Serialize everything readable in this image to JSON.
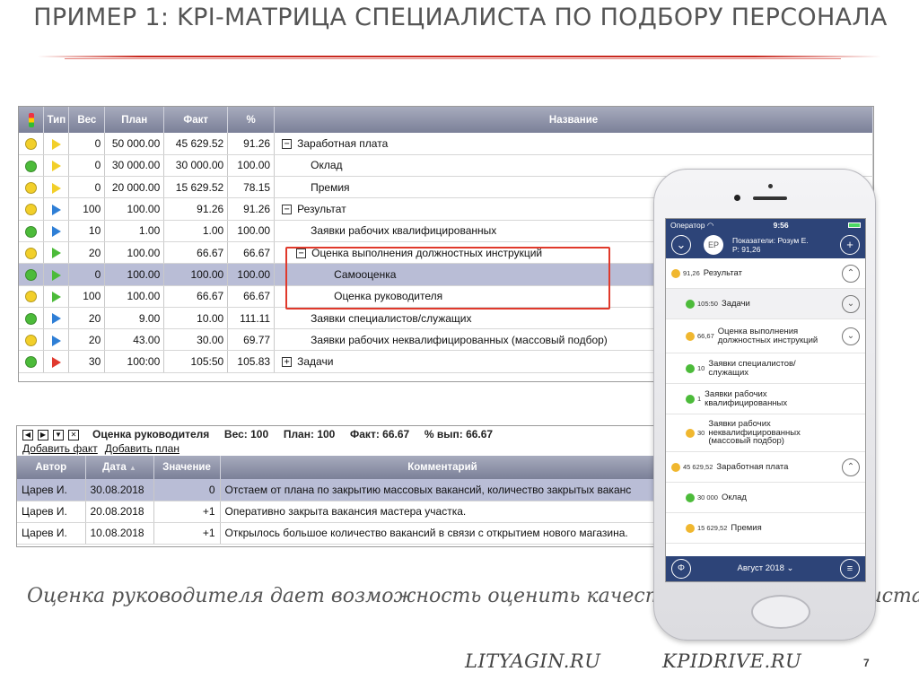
{
  "slide": {
    "title": "ПРИМЕР 1: KPI-МАТРИЦА СПЕЦИАЛИСТА ПО ПОДБОРУ ПЕРСОНАЛА",
    "caption": "Оценка руководителя дает возможность оценить качество работы специалиста",
    "footer_left": "LITYAGIN.RU",
    "footer_right": "KPIDRIVE.RU",
    "page": "7"
  },
  "colors": {
    "accent": "#c8281e",
    "header_grad": "#7b8098",
    "selected": "#b9bdd6",
    "yellow": "#f2cf2a",
    "green": "#4cbb3a",
    "red": "#e03a2f",
    "blue": "#2f7fd6",
    "app_blue": "#2d4478"
  },
  "kpi": {
    "columns": [
      "",
      "Тип",
      "Вес",
      "План",
      "Факт",
      "%",
      "Название"
    ],
    "rows": [
      {
        "status": "yellow",
        "type": "yellow",
        "weight": "0",
        "plan": "50 000.00",
        "fact": "45 629.52",
        "pct": "91.26",
        "toggle": "minus",
        "name": "Заработная плата",
        "level": 0
      },
      {
        "status": "green",
        "type": "yellow",
        "weight": "0",
        "plan": "30 000.00",
        "fact": "30 000.00",
        "pct": "100.00",
        "toggle": "",
        "name": "Оклад",
        "level": 1
      },
      {
        "status": "yellow",
        "type": "yellow",
        "weight": "0",
        "plan": "20 000.00",
        "fact": "15 629.52",
        "pct": "78.15",
        "toggle": "",
        "name": "Премия",
        "level": 1
      },
      {
        "status": "yellow",
        "type": "blue",
        "weight": "100",
        "plan": "100.00",
        "fact": "91.26",
        "pct": "91.26",
        "toggle": "minus",
        "name": "Результат",
        "level": 0
      },
      {
        "status": "green",
        "type": "blue",
        "weight": "10",
        "plan": "1.00",
        "fact": "1.00",
        "pct": "100.00",
        "toggle": "",
        "name": "Заявки рабочих квалифицированных",
        "level": 1
      },
      {
        "status": "yellow",
        "type": "green",
        "weight": "20",
        "plan": "100.00",
        "fact": "66.67",
        "pct": "66.67",
        "toggle": "minus",
        "name": "Оценка выполнения должностных инструкций",
        "level": 1
      },
      {
        "status": "green",
        "type": "green",
        "weight": "0",
        "plan": "100.00",
        "fact": "100.00",
        "pct": "100.00",
        "toggle": "",
        "name": "Самооценка",
        "level": 2,
        "selected": true
      },
      {
        "status": "yellow",
        "type": "green",
        "weight": "100",
        "plan": "100.00",
        "fact": "66.67",
        "pct": "66.67",
        "toggle": "",
        "name": "Оценка руководителя",
        "level": 2
      },
      {
        "status": "green",
        "type": "blue",
        "weight": "20",
        "plan": "9.00",
        "fact": "10.00",
        "pct": "111.11",
        "toggle": "",
        "name": "Заявки специалистов/служащих",
        "level": 1
      },
      {
        "status": "yellow",
        "type": "blue",
        "weight": "20",
        "plan": "43.00",
        "fact": "30.00",
        "pct": "69.77",
        "toggle": "",
        "name": "Заявки рабочих неквалифицированных (массовый подбор)",
        "level": 1
      },
      {
        "status": "green",
        "type": "red",
        "weight": "30",
        "plan": "100:00",
        "fact": "105:50",
        "pct": "105.83",
        "toggle": "plus",
        "name": "Задачи",
        "level": 0
      }
    ]
  },
  "detail": {
    "title": "Оценка руководителя",
    "weight": "Вес: 100",
    "plan": "План: 100",
    "fact": "Факт: 66.67",
    "pct": "% вып: 66.67",
    "add_fact": "Добавить факт",
    "add_plan": "Добавить план",
    "columns": [
      "Автор",
      "Дата",
      "Значение",
      "Комментарий"
    ],
    "rows": [
      {
        "author": "Царев И.",
        "date": "30.08.2018",
        "value": "0",
        "comment": "Отстаем от плана по закрытию массовых вакансий, количество закрытых ваканс",
        "selected": true
      },
      {
        "author": "Царев И.",
        "date": "20.08.2018",
        "value": "+1",
        "comment": "Оперативно закрыта вакансия мастера участка."
      },
      {
        "author": "Царев И.",
        "date": "10.08.2018",
        "value": "+1",
        "comment": "Открылось большое количество вакансий в связи с открытием нового магазина."
      }
    ]
  },
  "phone": {
    "carrier": "Оператор",
    "time": "9:56",
    "avatar": "ЕР",
    "header_line1": "Показатели: Розум Е.",
    "header_line2": "Р: 91,26",
    "month": "Август 2018 ⌄",
    "items": [
      {
        "color": "#f0b72f",
        "value": "91,26",
        "name": "Результат",
        "indent": 0,
        "chev": "up",
        "h": 34
      },
      {
        "color": "#4cbb3a",
        "value": "105:50",
        "name": "Задачи",
        "indent": 1,
        "chev": "down",
        "h": 34,
        "hl": true
      },
      {
        "color": "#f0b72f",
        "value": "66,67",
        "name": "Оценка выполнения должностных инструкций",
        "indent": 1,
        "chev": "down",
        "h": 38
      },
      {
        "color": "#4cbb3a",
        "value": "10",
        "name": "Заявки специалистов/ служащих",
        "indent": 1,
        "chev": "",
        "h": 34
      },
      {
        "color": "#4cbb3a",
        "value": "1",
        "name": "Заявки рабочих квалифицированных",
        "indent": 1,
        "chev": "",
        "h": 34
      },
      {
        "color": "#f0b72f",
        "value": "30",
        "name": "Заявки рабочих неквалифицированных (массовый подбор)",
        "indent": 1,
        "chev": "",
        "h": 42
      },
      {
        "color": "#f0b72f",
        "value": "45 629,52",
        "name": "Заработная плата",
        "indent": 0,
        "chev": "up",
        "h": 34
      },
      {
        "color": "#4cbb3a",
        "value": "30 000",
        "name": "Оклад",
        "indent": 1,
        "chev": "",
        "h": 34
      },
      {
        "color": "#f0b72f",
        "value": "15 629,52",
        "name": "Премия",
        "indent": 1,
        "chev": "",
        "h": 34
      }
    ]
  }
}
